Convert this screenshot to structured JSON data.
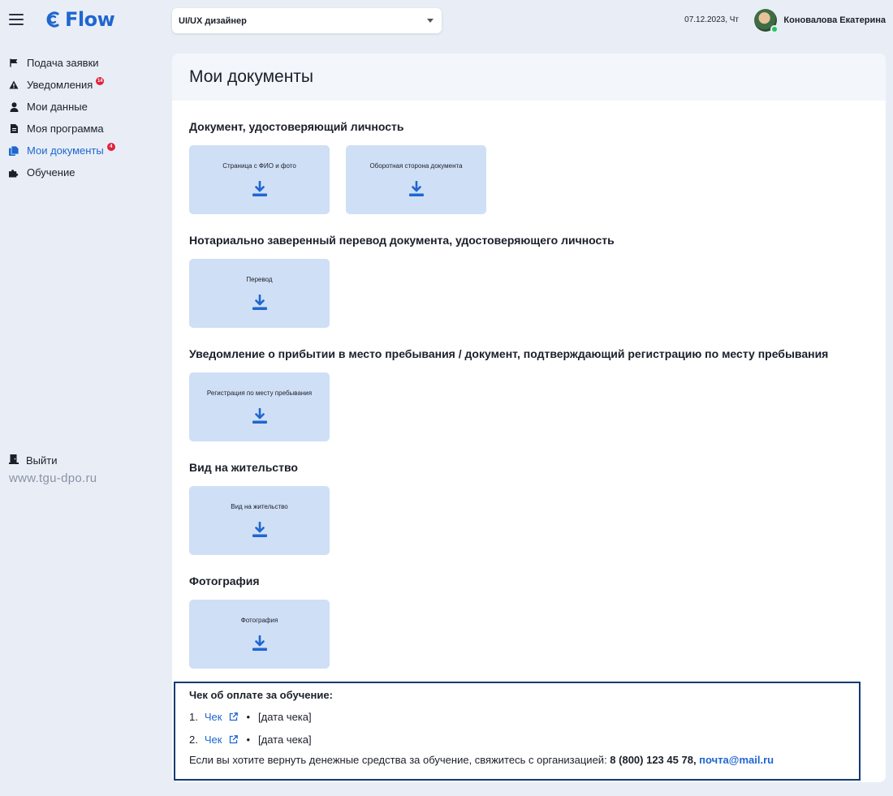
{
  "app": {
    "logo_text": "Flow"
  },
  "header": {
    "program_value": "UI/UX дизайнер",
    "date": "07.12.2023, Чт",
    "user_name": "Коновалова Екатерина"
  },
  "sidebar": {
    "items": [
      {
        "label": "Подача заявки",
        "icon": "flag-icon"
      },
      {
        "label": "Уведомления",
        "icon": "warning-icon",
        "badge": "14"
      },
      {
        "label": "Мои данные",
        "icon": "user-icon"
      },
      {
        "label": "Моя программа",
        "icon": "file-icon"
      },
      {
        "label": "Мои документы",
        "icon": "documents-icon",
        "badge": "4"
      },
      {
        "label": "Обучение",
        "icon": "puzzle-icon"
      }
    ],
    "logout_label": "Выйти",
    "site": "www.tgu-dpo.ru"
  },
  "page": {
    "title": "Мои документы",
    "sections": [
      {
        "title": "Документ, удостоверяющий личность",
        "tiles": [
          "Страница с ФИО и фото",
          "Оборотная сторона документа"
        ]
      },
      {
        "title": "Нотариально заверенный перевод документа, удостоверяющего личность",
        "tiles": [
          "Перевод"
        ]
      },
      {
        "title": "Уведомление о прибытии в место пребывания / документ, подтверждающий регистрацию по месту пребывания",
        "tiles": [
          "Регистрация по месту пребывания"
        ]
      },
      {
        "title": "Вид на жительство",
        "tiles": [
          "Вид на жительство"
        ]
      },
      {
        "title": "Фотография",
        "tiles": [
          "Фотография"
        ]
      }
    ]
  },
  "receipt": {
    "title": "Чек об оплате за обучение:",
    "rows": [
      {
        "num": "1.",
        "link": "Чек",
        "date": "[дата чека]"
      },
      {
        "num": "2.",
        "link": "Чек",
        "date": "[дата чека]"
      }
    ],
    "separator": "•",
    "note_text": "Если вы хотите вернуть денежные средства за обучение, свяжитесь с организацией: ",
    "phone": "8 (800) 123 45 78",
    "comma": ", ",
    "email": "почта@mail.ru"
  },
  "colors": {
    "accent": "#1f66d0",
    "tile": "#cfdff5",
    "badge": "#e0223c",
    "receipt_border": "#0f3b73"
  }
}
